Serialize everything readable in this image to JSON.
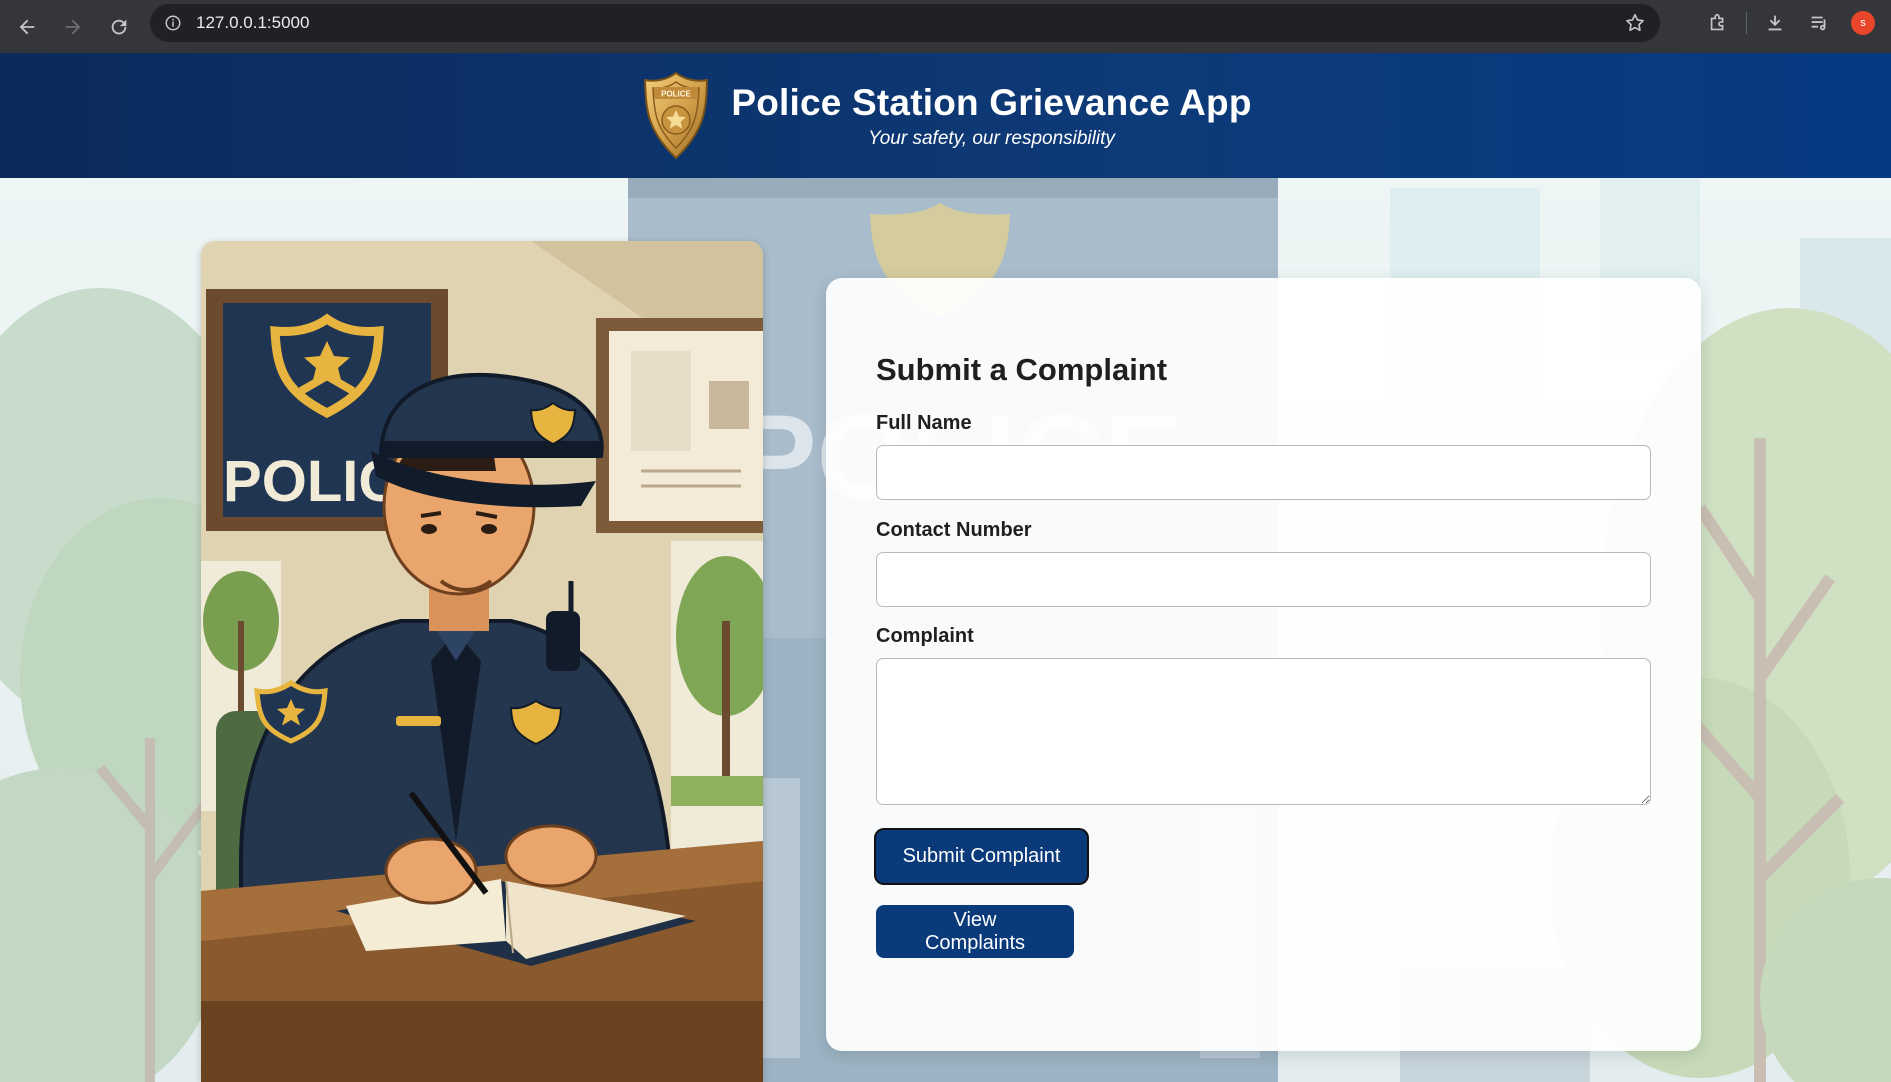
{
  "browser": {
    "url": "127.0.0.1:5000",
    "profile_initial": "s",
    "icons": [
      "back-arrow-icon",
      "forward-arrow-icon",
      "reload-icon",
      "site-info-icon",
      "bookmark-star-icon",
      "extensions-icon",
      "download-icon",
      "media-control-icon"
    ]
  },
  "header": {
    "title": "Police Station Grievance App",
    "subtitle": "Your safety, our responsibility",
    "badge_text": "POLICE",
    "colors": {
      "bar_start": "#0b2a5a",
      "bar_end": "#083a82",
      "badge_gold": "#d4a24c"
    }
  },
  "illustration": {
    "sign_text": "POLICE"
  },
  "form": {
    "title": "Submit a Complaint",
    "fields": {
      "full_name": {
        "label": "Full Name",
        "value": "",
        "placeholder": ""
      },
      "contact_number": {
        "label": "Contact Number",
        "value": "",
        "placeholder": ""
      },
      "complaint": {
        "label": "Complaint",
        "value": "",
        "placeholder": ""
      }
    },
    "submit_label": "Submit Complaint",
    "view_label": "View Complaints",
    "colors": {
      "button": "#0a3a7a"
    }
  }
}
